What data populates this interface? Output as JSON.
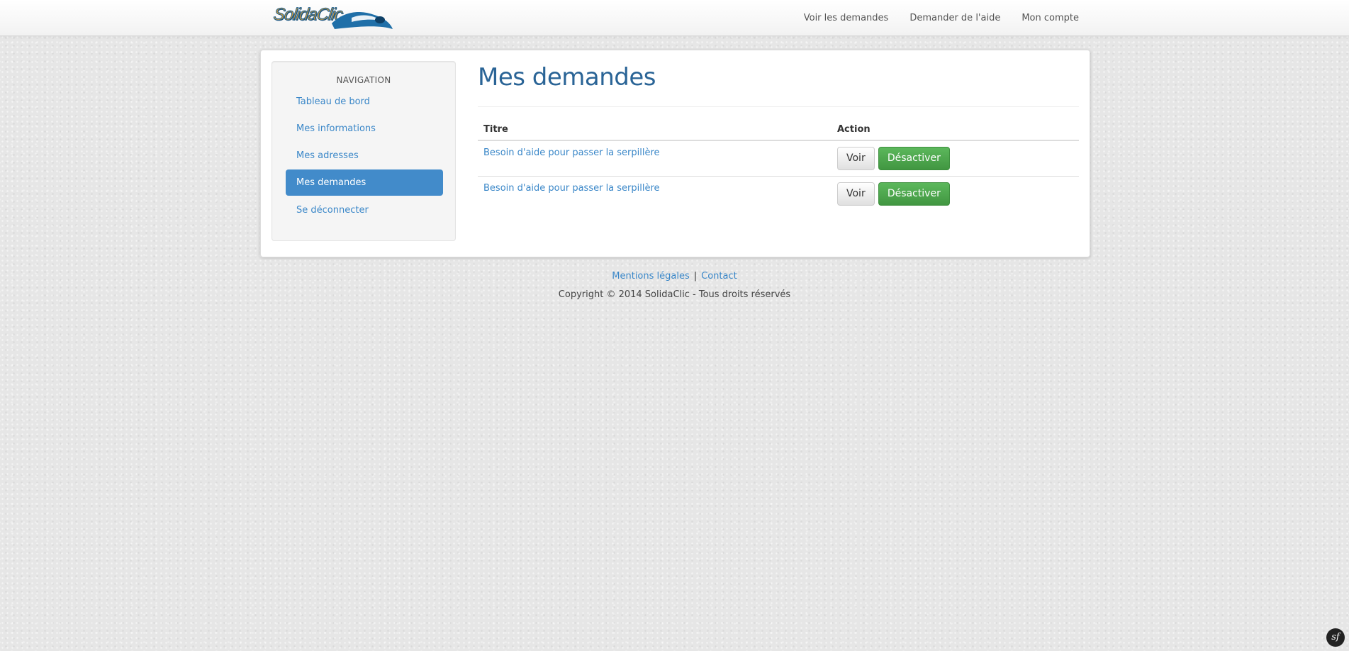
{
  "header": {
    "logo_text": "SolidaClic",
    "nav": [
      {
        "label": "Voir les demandes"
      },
      {
        "label": "Demander de l'aide"
      },
      {
        "label": "Mon compte"
      }
    ]
  },
  "sidebar": {
    "heading": "NAVIGATION",
    "items": [
      {
        "label": "Tableau de bord",
        "active": false
      },
      {
        "label": "Mes informations",
        "active": false
      },
      {
        "label": "Mes adresses",
        "active": false
      },
      {
        "label": "Mes demandes",
        "active": true
      },
      {
        "label": "Se déconnecter",
        "active": false
      }
    ]
  },
  "main": {
    "title": "Mes demandes",
    "table": {
      "columns": [
        "Titre",
        "Action"
      ],
      "rows": [
        {
          "title": "Besoin d'aide pour passer la serpillère",
          "view_label": "Voir",
          "deactivate_label": "Désactiver"
        },
        {
          "title": "Besoin d'aide pour passer la serpillère",
          "view_label": "Voir",
          "deactivate_label": "Désactiver"
        }
      ]
    }
  },
  "footer": {
    "legal_label": "Mentions légales",
    "separator": "|",
    "contact_label": "Contact",
    "copyright": "Copyright © 2014 SolidaClic - Tous droits réservés"
  },
  "debug_toolbar": {
    "label": "sf"
  },
  "colors": {
    "accent": "#428bca",
    "link": "#3a87c8",
    "title": "#2a6496",
    "success": "#5cb85c"
  }
}
